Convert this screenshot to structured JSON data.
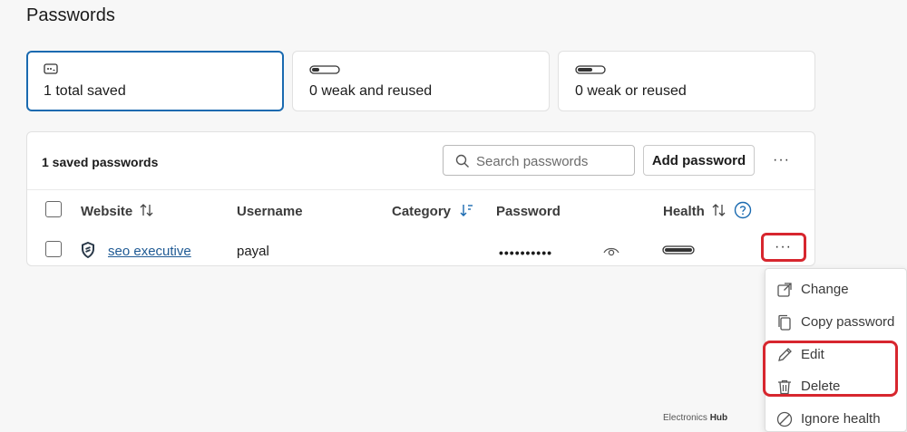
{
  "page": {
    "title": "Passwords"
  },
  "stats": [
    {
      "label": "1 total saved",
      "icon": "password-card-icon"
    },
    {
      "label": "0 weak and reused",
      "icon": "strength-bar-icon"
    },
    {
      "label": "0 weak or reused",
      "icon": "strength-bar-icon"
    }
  ],
  "panel": {
    "title": "1 saved passwords",
    "search_placeholder": "Search passwords",
    "add_label": "Add password",
    "more_label": "···"
  },
  "table": {
    "columns": {
      "website": "Website",
      "username": "Username",
      "category": "Category",
      "password": "Password",
      "health": "Health"
    },
    "rows": [
      {
        "website": "seo executive",
        "username": "payal",
        "password_mask": "••••••••••",
        "health_icon": "health-bar-icon"
      }
    ]
  },
  "row_more_label": "···",
  "menu": {
    "items": [
      {
        "label": "Change",
        "icon": "external-link-icon"
      },
      {
        "label": "Copy password",
        "icon": "copy-icon"
      },
      {
        "label": "Edit",
        "icon": "pencil-icon"
      },
      {
        "label": "Delete",
        "icon": "trash-icon"
      },
      {
        "label": "Ignore health",
        "icon": "block-icon"
      }
    ]
  },
  "watermark": {
    "prefix": "Electronics",
    "suffix": "Hub"
  },
  "colors": {
    "accent": "#1a6ab0",
    "highlight": "#d7262e",
    "link": "#1f5a94"
  }
}
